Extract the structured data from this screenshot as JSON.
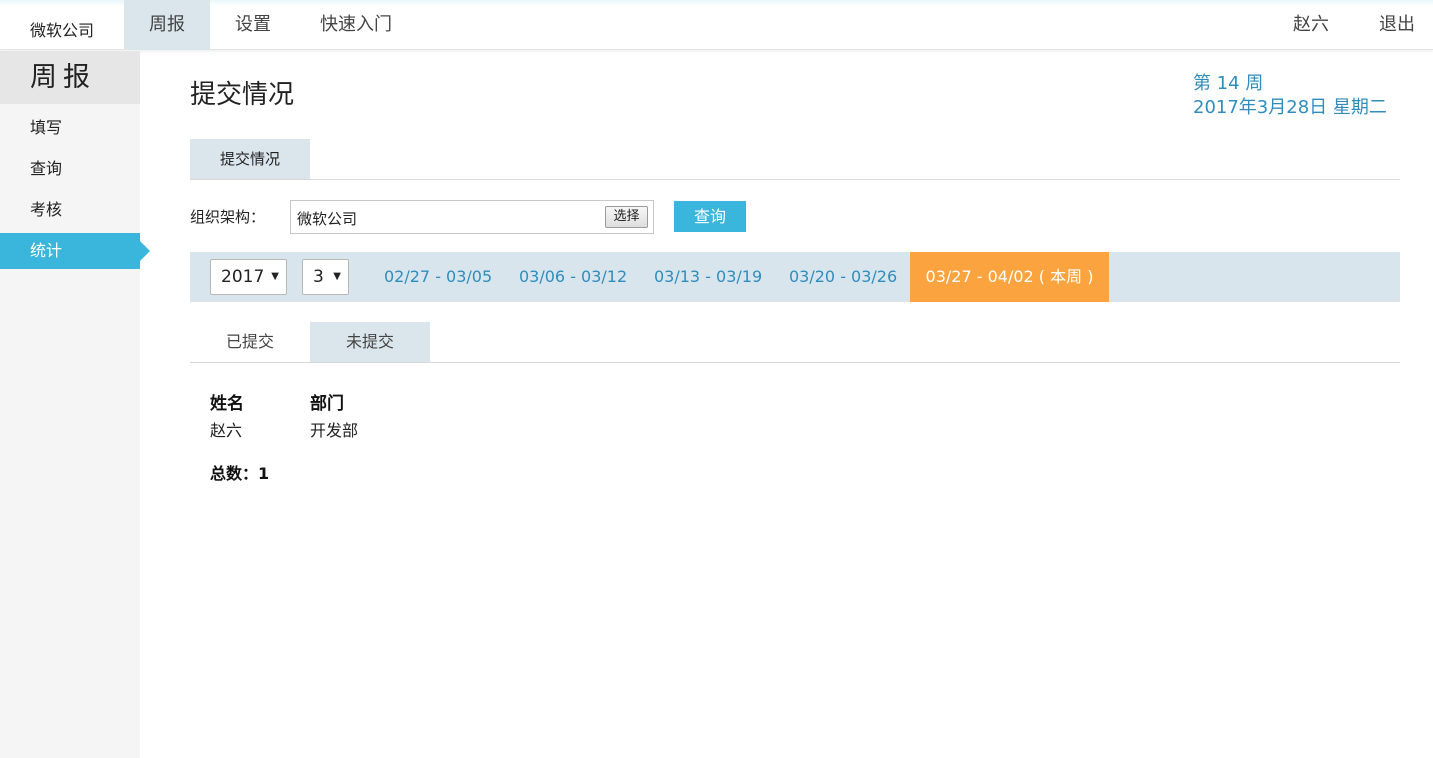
{
  "topbar": {
    "brand": "微软公司",
    "nav": {
      "weekly": "周报",
      "settings": "设置",
      "quickstart": "快速入门"
    },
    "user": "赵六",
    "logout": "退出"
  },
  "sidebar": {
    "title": "周报",
    "items": [
      {
        "label": "填写"
      },
      {
        "label": "查询"
      },
      {
        "label": "考核"
      },
      {
        "label": "统计",
        "active": true
      }
    ]
  },
  "main": {
    "page_title": "提交情况",
    "week_number": "第 14 周",
    "current_date": "2017年3月28日 星期二",
    "tab": "提交情况",
    "org": {
      "label": "组织架构：",
      "value": "微软公司",
      "select_label": "选择"
    },
    "query_label": "查询",
    "year": "2017",
    "month": "3",
    "weeks": [
      "02/27 - 03/05",
      "03/06 - 03/12",
      "03/13 - 03/19",
      "03/20 - 03/26"
    ],
    "current_week": "03/27 - 04/02 ( 本周 )",
    "status_tabs": {
      "submitted": "已提交",
      "unsubmitted": "未提交"
    },
    "table": {
      "headers": [
        "姓名",
        "部门"
      ],
      "rows": [
        [
          "赵六",
          "开发部"
        ]
      ]
    },
    "total": "总数：1"
  },
  "colors": {
    "accent": "#3ab6dc",
    "link": "#2f8dbd",
    "current_week": "#fba33e",
    "tab_bg": "#dbe6ec"
  }
}
